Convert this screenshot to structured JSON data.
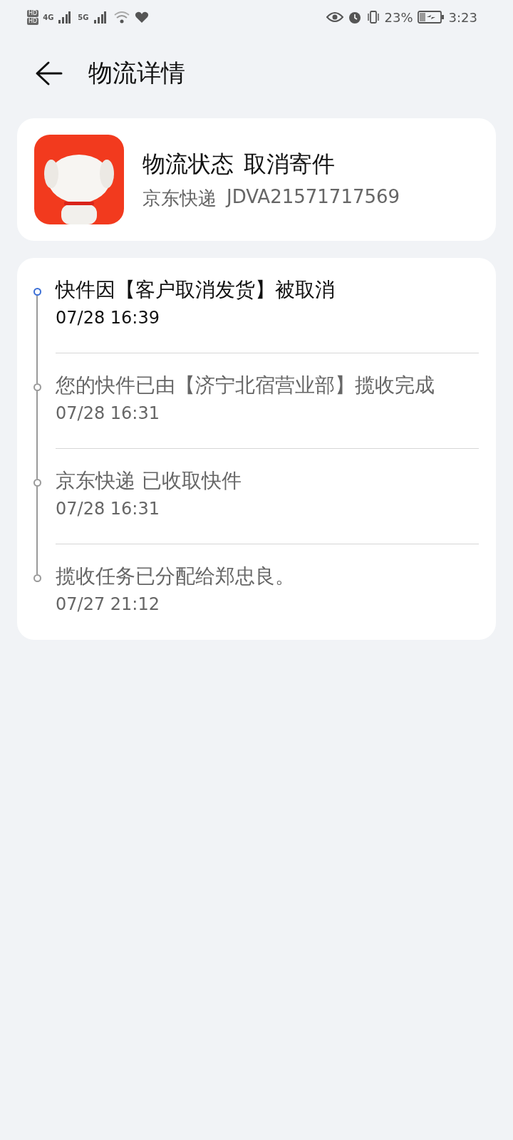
{
  "status_bar": {
    "sim_badges": [
      "HD",
      "HD"
    ],
    "networks": [
      "4G",
      "5G"
    ],
    "battery": "23%",
    "time": "3:23"
  },
  "header": {
    "title": "物流详情"
  },
  "summary": {
    "status_label": "物流状态",
    "status": "取消寄件",
    "carrier": "京东快递",
    "tracking_number": "JDVA21571717569"
  },
  "timeline": [
    {
      "text": "快件因【客户取消发货】被取消",
      "time": "07/28 16:39",
      "current": true
    },
    {
      "text": "您的快件已由【济宁北宿营业部】揽收完成",
      "time": "07/28 16:31",
      "current": false
    },
    {
      "text": "京东快递 已收取快件",
      "time": "07/28 16:31",
      "current": false
    },
    {
      "text": "揽收任务已分配给郑忠良。",
      "time": "07/27 21:12",
      "current": false
    }
  ]
}
